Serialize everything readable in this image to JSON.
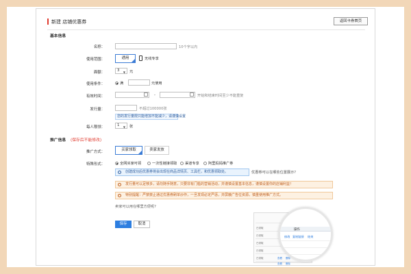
{
  "page": {
    "title": "新建 店铺优惠券",
    "return_label": "返回卡券首页"
  },
  "basic": {
    "section_title": "基本信息",
    "name_label": "名称：",
    "name_hint": "10个字以内",
    "scope_label": "使用范围：",
    "scope_general": "通用",
    "scope_wireless": "无线专享",
    "denomination_label": "面额：",
    "denomination_value": "3",
    "denomination_unit": "元",
    "condition_label": "使用条件：",
    "condition_prefix": "满",
    "condition_unit": "元使用",
    "valid_label": "有效时间：",
    "valid_separator": "-",
    "valid_hint": "开始和结束时间至少不能重复",
    "quantity_label": "发行量：",
    "quantity_hint": "不超过100000张",
    "quantity_notice": "您的发行量限只能增加不能减少，请谨慎设置",
    "limit_label": "每人限领：",
    "limit_value": "1",
    "limit_unit": "张"
  },
  "promotion": {
    "section_title": "推广信息",
    "section_note": "(保存后不能修改)",
    "method_label": "推广方式：",
    "method_buyer": "买家领取",
    "method_seller": "卖家发放",
    "special_label": "特殊形式：",
    "radio_all": "全网买家可领",
    "radio_link": "一次性链接领取",
    "radio_exclusive": "渠道专享",
    "radio_other": "阿里妈妈推广券",
    "info_text": "创建成功后优惠券将会出现在商品详情页、工具栏，和优惠领取处。",
    "info_suffix": "优惠券可以在哪些位置展示?",
    "warn1": "发行量可以足够多，请勿随手随意，只要非有门槛的营销活动，并谨慎设置基本信息，谨慎设置你的店铺利益！",
    "warn2": "特别提醒：严禁禁止通过优惠券刷单炒作，一旦发现必定严惩，并屏蔽广告位资源，慎重使用推广方式。",
    "question": "卖家可以用在哪里方便呢?"
  },
  "actions": {
    "save_label": "保存",
    "cancel_label": "取消"
  },
  "preview": {
    "header": "操作",
    "link_a": "修改",
    "link_b": "复制链接",
    "link_c": "结束",
    "row_labels": [
      "已领取",
      "已领取",
      "已领取",
      "已领取",
      "已领取",
      "已领取"
    ],
    "row_link_a": "查看",
    "row_link_b": "删除"
  },
  "colors": {
    "accent": "#e03b2f",
    "primary": "#2d7ee0",
    "border_frame": "#f2d7b8"
  }
}
